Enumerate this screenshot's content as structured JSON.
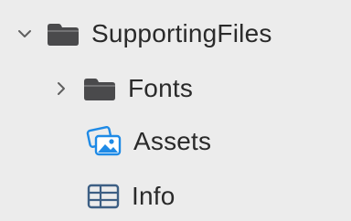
{
  "tree": {
    "items": [
      {
        "label": "SupportingFiles",
        "icon": "folder-icon",
        "expanded": true
      },
      {
        "label": "Fonts",
        "icon": "folder-icon",
        "expanded": false
      },
      {
        "label": "Assets",
        "icon": "asset-catalog-icon"
      },
      {
        "label": "Info",
        "icon": "plist-table-icon"
      }
    ]
  },
  "colors": {
    "background": "#ececec",
    "folder": "#4a4a4c",
    "asset_blue": "#1e8ae6",
    "plist_blue": "#3d5f84",
    "chevron": "#5f5f5f",
    "text": "#2a2a2a"
  }
}
